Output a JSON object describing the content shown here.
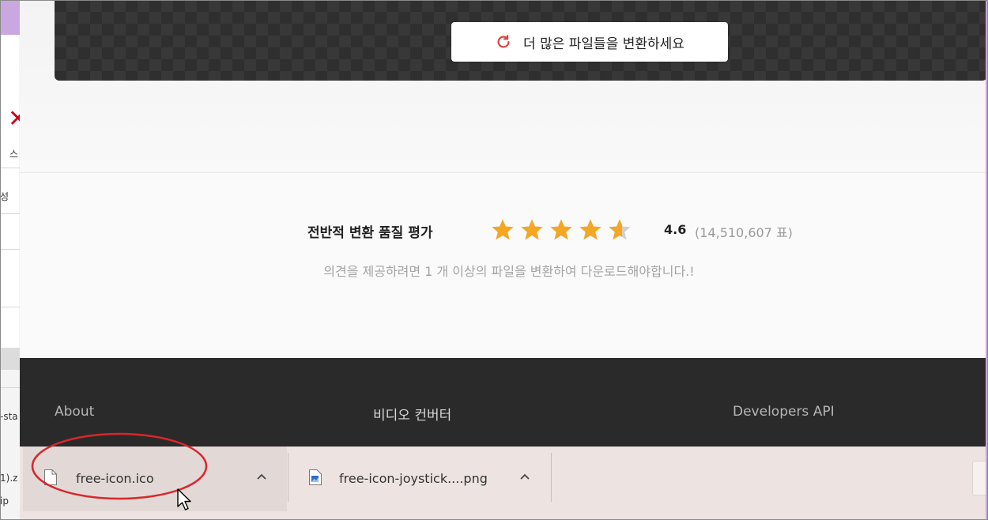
{
  "background_window": {
    "left_texts": [
      "스",
      "성",
      "-sta",
      "1).z",
      "ip"
    ]
  },
  "converter": {
    "convert_more_label": "더 많은 파일들을 변환하세요",
    "refresh_icon": "refresh-icon"
  },
  "rating": {
    "label": "전반적 변환 품질 평가",
    "stars": 4.6,
    "score": "4.6",
    "votes": "(14,510,607 표)",
    "note": "의견을 제공하려면 1 개 이상의 파일을 변환하여 다운로드해야합니다.!",
    "star_color": "#f5a623"
  },
  "footer": {
    "about": "About",
    "video_converter": "비디오 컨버터",
    "developers_api": "Developers API"
  },
  "downloads": [
    {
      "name": "free-icon.ico",
      "icon": "file-icon"
    },
    {
      "name": "free-icon-joystick....png",
      "icon": "image-file-icon"
    }
  ],
  "colors": {
    "annotation": "#d9262c",
    "footer_bg": "#2a2a2a",
    "download_bar_bg": "#ede4e1"
  }
}
